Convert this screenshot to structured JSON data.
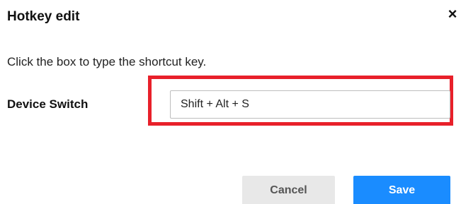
{
  "dialog": {
    "title": "Hotkey edit",
    "close_glyph": "×",
    "instruction": "Click the box to type the shortcut key.",
    "field": {
      "label": "Device Switch",
      "value": "Shift + Alt + S"
    },
    "buttons": {
      "cancel_label": "Cancel",
      "save_label": "Save"
    }
  },
  "colors": {
    "highlight_border": "#e8202a",
    "save_button": "#1a8cff",
    "cancel_button": "#e8e8e8"
  },
  "icons": {
    "close": "close-icon"
  }
}
